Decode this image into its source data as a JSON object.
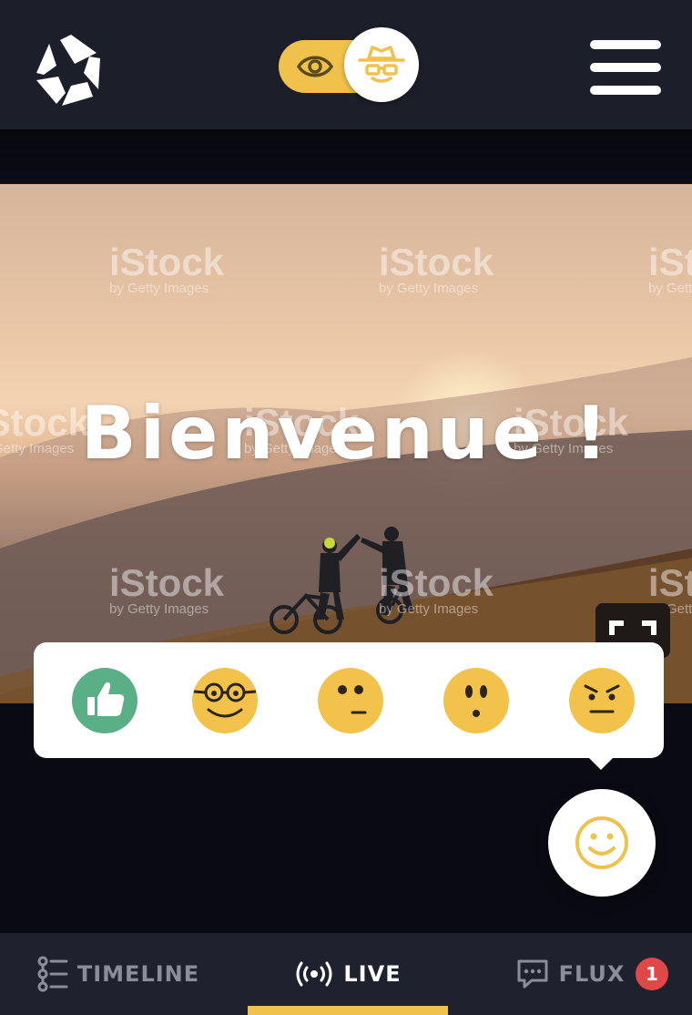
{
  "header": {
    "logo_icon": "camera-aperture-logo-icon",
    "mode_toggle": {
      "left_icon": "eye-icon",
      "right_icon": "incognito-spy-icon",
      "active": "incognito"
    },
    "menu_icon": "hamburger-menu-icon"
  },
  "hero": {
    "headline": "Bienvenue !",
    "watermark_brand": "iStock",
    "watermark_sub": "by Getty Images",
    "fullscreen_icon": "fullscreen-icon"
  },
  "reactions": {
    "items": [
      {
        "name": "thumbs-up",
        "icon": "thumbs-up-icon",
        "color": "#5aaf86"
      },
      {
        "name": "nerd",
        "icon": "nerd-face-icon",
        "color": "#f2c24b"
      },
      {
        "name": "skeptical",
        "icon": "skeptical-face-icon",
        "color": "#f2c24b"
      },
      {
        "name": "surprised",
        "icon": "surprised-face-icon",
        "color": "#f2c24b"
      },
      {
        "name": "annoyed",
        "icon": "annoyed-face-icon",
        "color": "#f2c24b"
      }
    ]
  },
  "fab": {
    "icon": "smiley-icon"
  },
  "tabs": [
    {
      "label": "TIMELINE",
      "icon": "timeline-list-icon",
      "active": false
    },
    {
      "label": "LIVE",
      "icon": "live-broadcast-icon",
      "active": true
    },
    {
      "label": "FLUX",
      "icon": "chat-bubble-icon",
      "active": false,
      "badge": "1"
    }
  ],
  "colors": {
    "accent": "#f0c24c",
    "header_bg": "#1c1e29",
    "tabbar_bg": "#1f222e",
    "badge": "#e04848",
    "thumbs_green": "#5aaf86"
  }
}
